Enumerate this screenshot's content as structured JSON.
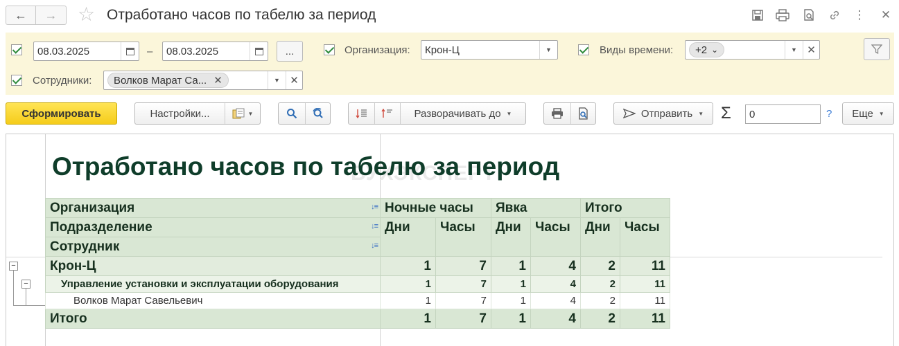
{
  "window": {
    "title": "Отработано часов по табелю за период"
  },
  "filters": {
    "date_from": "08.03.2025",
    "date_sep": "–",
    "date_to": "08.03.2025",
    "period_button": "...",
    "org_label": "Организация:",
    "org_value": "Крон-Ц",
    "timetypes_label": "Виды времени:",
    "timetypes_chip": "+2",
    "employees_label": "Сотрудники:",
    "employees_chip": "Волков Марат Са..."
  },
  "toolbar": {
    "generate": "Сформировать",
    "settings": "Настройки...",
    "expand_to": "Разворачивать до",
    "send": "Отправить",
    "sum_value": "0",
    "sum_help": "?",
    "more": "Еще"
  },
  "report": {
    "title": "Отработано часов по табелю за период",
    "watermark": "БУХЭКСПЕРТ",
    "group_headers": [
      "Организация",
      "Подразделение",
      "Сотрудник"
    ],
    "column_groups": [
      "Ночные часы",
      "Явка",
      "Итого"
    ],
    "sub_headers": [
      "Дни",
      "Часы",
      "Дни",
      "Часы",
      "Дни",
      "Часы"
    ],
    "rows": [
      {
        "label": "Крон-Ц",
        "values": [
          "1",
          "7",
          "1",
          "4",
          "2",
          "11"
        ]
      },
      {
        "label": "Управление установки и эксплуатации оборудования",
        "values": [
          "1",
          "7",
          "1",
          "4",
          "2",
          "11"
        ]
      },
      {
        "label": "Волков Марат Савельевич",
        "values": [
          "1",
          "7",
          "1",
          "4",
          "2",
          "11"
        ]
      }
    ],
    "total": {
      "label": "Итого",
      "values": [
        "1",
        "7",
        "1",
        "4",
        "2",
        "11"
      ]
    }
  }
}
